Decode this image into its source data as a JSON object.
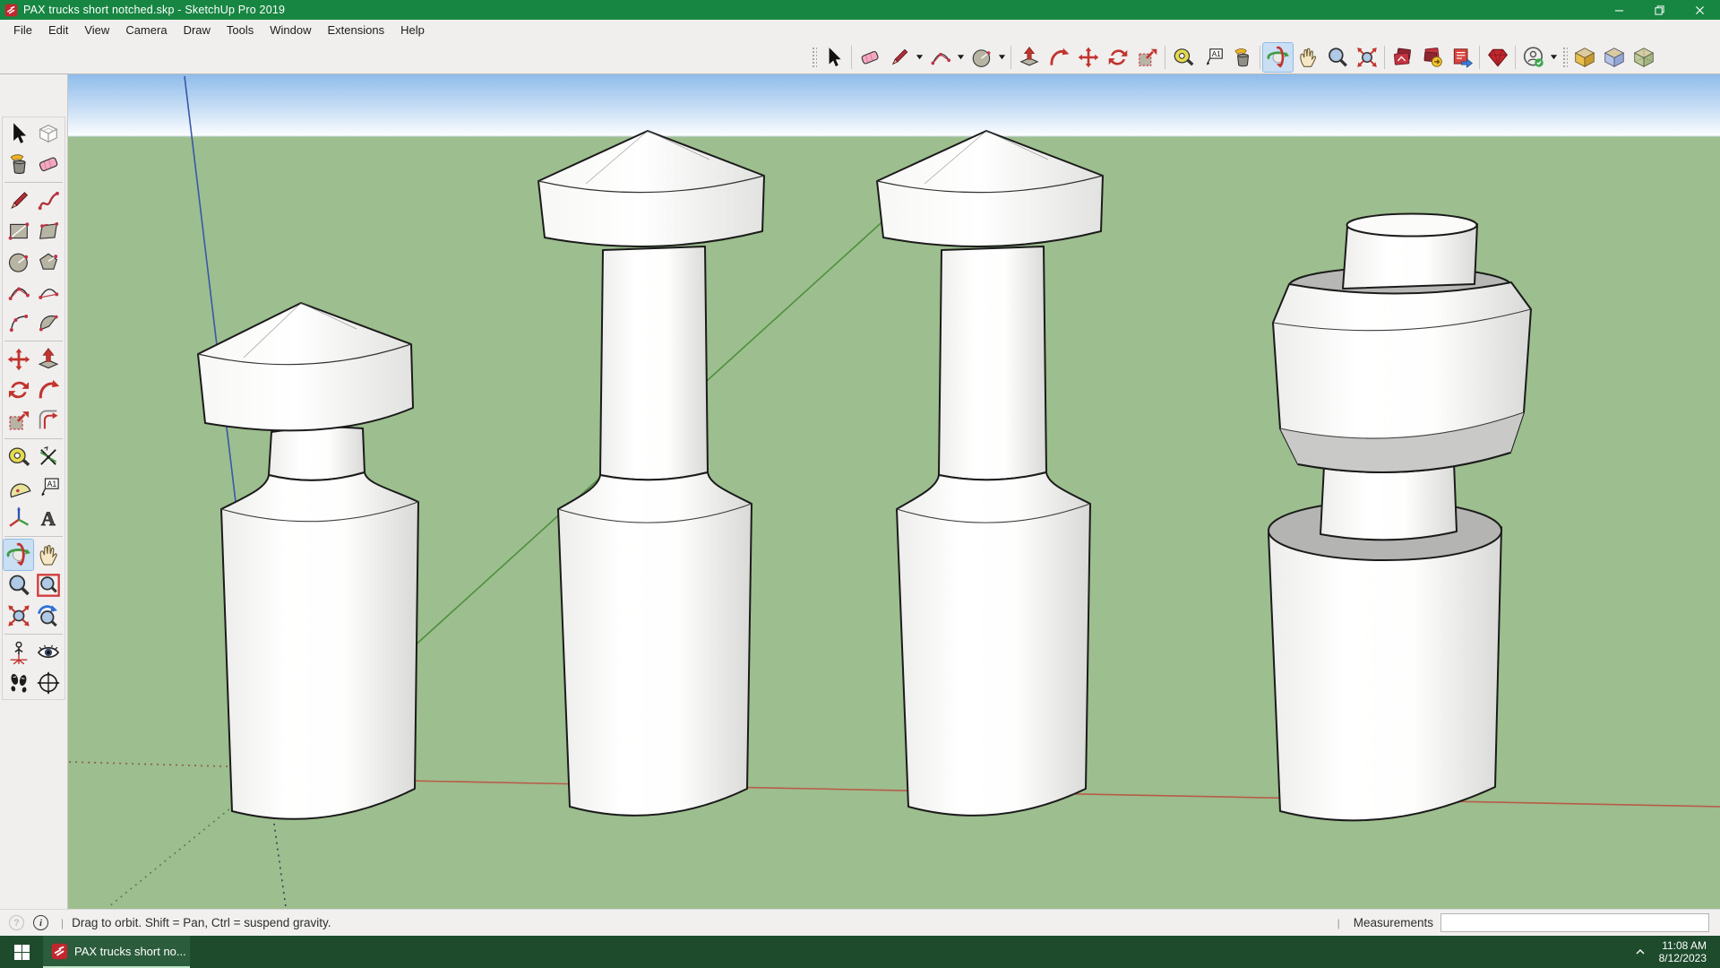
{
  "window": {
    "app_icon": "sketchup-logo",
    "title": "PAX trucks short notched.skp - SketchUp Pro 2019",
    "controls": [
      "minimize",
      "restore",
      "close"
    ]
  },
  "menu": {
    "items": [
      "File",
      "Edit",
      "View",
      "Camera",
      "Draw",
      "Tools",
      "Window",
      "Extensions",
      "Help"
    ]
  },
  "toolbar": {
    "active_tool": "orbit",
    "icons": [
      "select",
      "eraser",
      "line",
      "arc",
      "shapes",
      "push-pull",
      "follow-me",
      "move",
      "rotate",
      "scale",
      "tape-measure",
      "text",
      "paint-bucket",
      "orbit",
      "pan",
      "zoom",
      "zoom-extents",
      "3d-warehouse",
      "share-model",
      "generate-report",
      "extension-warehouse",
      "account",
      "iso-view-1",
      "iso-view-2",
      "iso-view-3"
    ],
    "dropdown_after": [
      "line",
      "arc",
      "shapes",
      "account"
    ]
  },
  "left_toolbar": {
    "active_tool": "orbit",
    "rows": [
      [
        "select",
        "make-component"
      ],
      [
        "paint-bucket",
        "eraser"
      ],
      [
        "line",
        "freehand"
      ],
      [
        "rectangle",
        "rotated-rectangle"
      ],
      [
        "circle",
        "polygon"
      ],
      [
        "arc",
        "2-point-arc"
      ],
      [
        "3-point-arc",
        "pie"
      ],
      [
        "move",
        "push-pull"
      ],
      [
        "rotate",
        "follow-me"
      ],
      [
        "scale",
        "offset"
      ],
      [
        "tape-measure",
        "dimensions"
      ],
      [
        "protractor",
        "text"
      ],
      [
        "axes",
        "3d-text"
      ],
      [
        "orbit",
        "pan"
      ],
      [
        "zoom",
        "zoom-window"
      ],
      [
        "zoom-extents",
        "zoom-previous"
      ],
      [
        "position-camera",
        "look-around"
      ],
      [
        "walk",
        "turn-compass"
      ]
    ]
  },
  "viewport": {
    "description": "Four white lathed pawn-like truck models on green ground under blue sky",
    "sky_top_color": "#8FBCEA",
    "ground_color": "#9DBE8E",
    "axis_colors": {
      "blue": "#3A57A8",
      "green": "#4F8F3F",
      "red": "#B85C49"
    }
  },
  "statusbar": {
    "geolocation_icon": "circle-question",
    "context_icon": "circle-info",
    "help_text": "Drag to orbit. Shift = Pan, Ctrl = suspend gravity.",
    "measurements_label": "Measurements",
    "measurements_value": ""
  },
  "taskbar": {
    "start": "windows-start",
    "app": {
      "icon": "sketchup-logo",
      "label": "PAX trucks short no...",
      "active": true
    },
    "tray": {
      "chevron": "hidden-icons-chevron",
      "time": "11:08 AM",
      "date": "8/12/2023"
    }
  }
}
